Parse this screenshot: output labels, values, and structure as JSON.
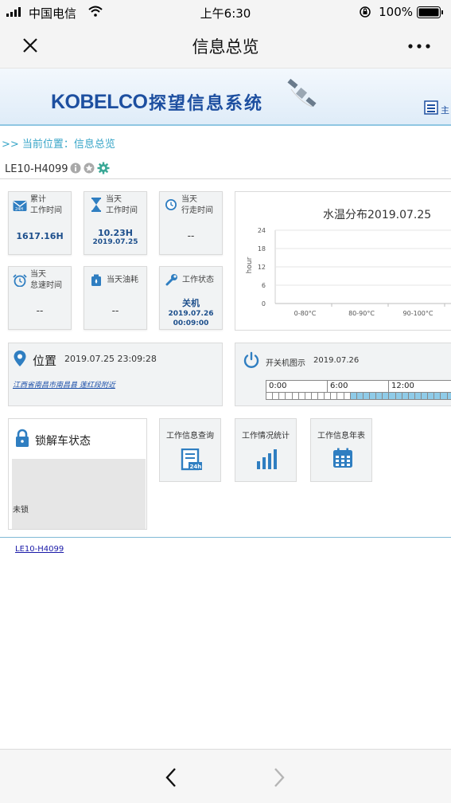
{
  "status_bar": {
    "carrier": "中国电信",
    "time": "上午6:30",
    "battery": "100%"
  },
  "nav": {
    "title": "信息总览",
    "close_icon": "close-icon",
    "more_icon": "more-icon"
  },
  "banner": {
    "brand": "KOBELCO",
    "system_name": "探望信息系统",
    "home_label": "主"
  },
  "breadcrumb": {
    "text": ">> 当前位置：信息总览"
  },
  "machine": {
    "id": "LE10-H4099"
  },
  "tiles": {
    "total_work_time": {
      "label_line1": "累计",
      "label_line2": "工作时间",
      "value": "1617.16H"
    },
    "today_work_time": {
      "label_line1": "当天",
      "label_line2": "工作时间",
      "value": "10.23H",
      "date": "2019.07.25"
    },
    "today_travel_time": {
      "label_line1": "当天",
      "label_line2": "行走时间",
      "value": "--"
    },
    "today_idle_time": {
      "label_line1": "当天",
      "label_line2": "怠速时间",
      "value": "--"
    },
    "today_fuel": {
      "label": "当天油耗",
      "value": "--"
    },
    "work_status": {
      "label": "工作状态",
      "value": "关机",
      "date": "2019.07.26",
      "time": "00:09:00"
    }
  },
  "chart_data": {
    "type": "bar",
    "title": "水温分布2019.07.25",
    "ylabel": "hour",
    "xlabel": "",
    "categories": [
      "0-80°C",
      "80-90°C",
      "90-100°C"
    ],
    "values": [
      0,
      0,
      0
    ],
    "yticks": [
      "0",
      "6",
      "12",
      "18",
      "24"
    ],
    "ylim": [
      0,
      24
    ],
    "grid": true
  },
  "location": {
    "title": "位置",
    "datetime": "2019.07.25 23:09:28",
    "address": "江西省南昌市南昌县 莲红段附近"
  },
  "power": {
    "title": "开关机图示",
    "date": "2019.07.26",
    "segments": [
      "0:00",
      "6:00",
      "12:00"
    ],
    "cells": [
      0,
      0,
      0,
      0,
      0,
      0,
      0,
      0,
      0,
      0,
      0,
      0,
      0,
      1,
      1,
      1,
      1,
      1,
      1,
      1,
      1,
      1,
      1,
      1,
      1,
      1,
      1,
      1,
      1,
      1,
      1,
      1
    ]
  },
  "lock": {
    "title": "锁解车状态",
    "status": "未锁"
  },
  "functions": {
    "work_info_query": "工作信息查询",
    "work_stats": "工作情况统计",
    "work_info_yearly": "工作信息年表"
  },
  "footer": {
    "link": "LE10-H4099"
  },
  "colors": {
    "brand_blue": "#1d4fa0",
    "accent_cyan": "#39a6c8",
    "value_blue": "#1d4f8c",
    "tile_bg": "#f1f3f4"
  }
}
